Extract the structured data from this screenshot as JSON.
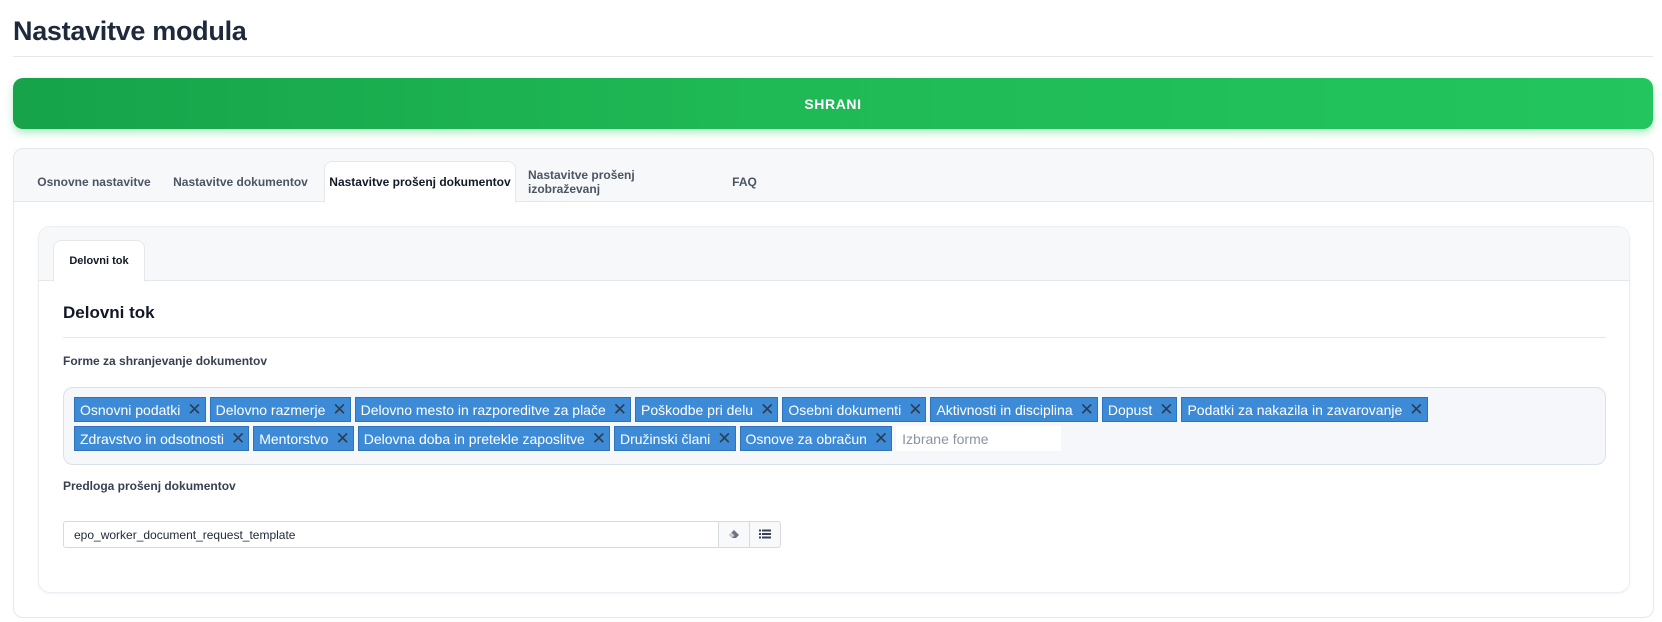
{
  "page": {
    "title": "Nastavitve modula",
    "save_label": "SHRANI"
  },
  "tabs": [
    {
      "label": "Osnovne nastavitve",
      "active": false
    },
    {
      "label": "Nastavitve dokumentov",
      "active": false
    },
    {
      "label": "Nastavitve prošenj dokumentov",
      "active": true
    },
    {
      "label": "Nastavitve prošenj izobraževanj",
      "active": false
    },
    {
      "label": "FAQ",
      "active": false
    }
  ],
  "sub_tabs": [
    {
      "label": "Delovni tok",
      "active": true
    }
  ],
  "section": {
    "title": "Delovni tok",
    "forms_label": "Forme za shranjevanje dokumentov",
    "selected_forms_row1": [
      "Osnovni podatki",
      "Delovno razmerje",
      "Delovno mesto in razporeditve za plače",
      "Poškodbe pri delu",
      "Osebni dokumenti",
      "Aktivnosti in disciplina",
      "Dopust",
      "Podatki za nakazila in zavarovanje"
    ],
    "selected_forms_row2": [
      "Zdravstvo in odsotnosti",
      "Mentorstvo",
      "Delovna doba in pretekle zaposlitve",
      "Družinski člani",
      "Osnove za obračun"
    ],
    "forms_placeholder": "Izbrane forme",
    "template_label": "Predloga prošenj dokumentov",
    "template_value": "epo_worker_document_request_template",
    "template_icons": [
      "eraser-icon",
      "list-icon"
    ]
  },
  "colors": {
    "save_gradient_start": "#16a34a",
    "save_gradient_end": "#22c55e",
    "tag_background": "#3d8bd6"
  }
}
